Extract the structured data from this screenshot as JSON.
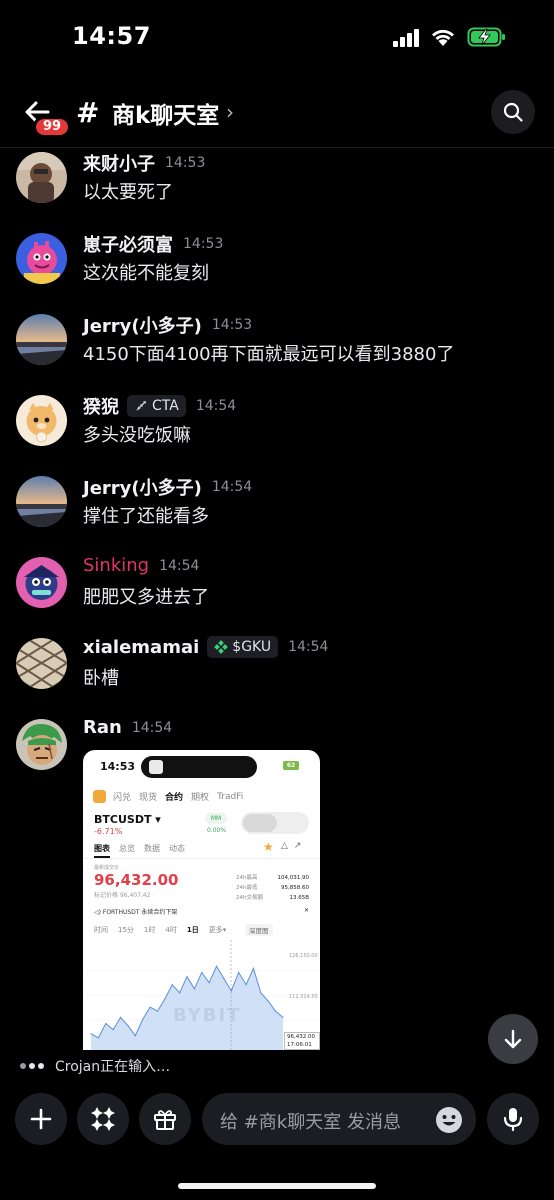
{
  "status_bar": {
    "time": "14:57"
  },
  "header": {
    "unread_count": "99",
    "channel_hash": "#",
    "channel_name": "商k聊天室",
    "chevron": "›"
  },
  "messages": [
    {
      "author": "来财小子",
      "time": "14:53",
      "text": "以太要死了",
      "avatar": "figure-avatar"
    },
    {
      "author": "崽子必须富",
      "time": "14:53",
      "text": "这次能不能复刻",
      "avatar": "pink-monster-avatar"
    },
    {
      "author": "Jerry(小多子)",
      "time": "14:53",
      "text": "4150下面4100再下面就最远可以看到3880了",
      "avatar": "sunset-river-avatar"
    },
    {
      "author": "猤猊",
      "time": "14:54",
      "tag": "CTA",
      "tag_icon": "rocket-icon",
      "text": "多头没吃饭嘛",
      "avatar": "cute-tiger-avatar"
    },
    {
      "author": "Jerry(小多子)",
      "time": "14:54",
      "text": "撑住了还能看多",
      "avatar": "sunset-river-avatar"
    },
    {
      "author": "Sinking",
      "time": "14:54",
      "text": "肥肥又多进去了",
      "avatar": "cartoon-avatar",
      "author_color": "#e0336d"
    },
    {
      "author": "xialemamai",
      "time": "14:54",
      "tag": "$GKU",
      "tag_icon": "clover-icon",
      "text": "卧槽",
      "avatar": "floor-tile-avatar"
    },
    {
      "author": "Ran",
      "time": "14:54",
      "avatar": "green-hair-avatar"
    }
  ],
  "attachment": {
    "time": "14:53",
    "battery": "62",
    "nav": [
      "闪兑",
      "现货",
      "合约",
      "期权",
      "TradFi"
    ],
    "nav_active": "合约",
    "pair": "BTCUSDT ▾",
    "change": "-6.71%",
    "mm_label": "MM",
    "mm_value": "0.00%",
    "tabs": [
      "图表",
      "总览",
      "数据",
      "动态"
    ],
    "tab_active": "图表",
    "last_price_label": "最新成交价",
    "last_price": "96,432.00",
    "mark_price": "标记价格 96,407.42",
    "stats_labels": [
      "24h最高",
      "24h最低",
      "24h交易额"
    ],
    "stats_values": [
      "104,031.90",
      "95,858.60",
      "13.65B"
    ],
    "banner": "FORTHUSDT 永续合约下架",
    "banner_close": "✕",
    "intervals": [
      "时间",
      "15分",
      "1时",
      "4时",
      "1日",
      "更多▾"
    ],
    "interval_active": "1日",
    "depth_label": "深度图",
    "axis_labels": [
      "126,150.00",
      "111,314.50"
    ],
    "current_box": [
      "96,432.00",
      "17:06:01"
    ],
    "watermark": "BYBIT",
    "chart_data": {
      "type": "area",
      "values": [
        88,
        86,
        93,
        90,
        96,
        92,
        87,
        95,
        101,
        99,
        105,
        112,
        108,
        116,
        110,
        118,
        113,
        121,
        115,
        109,
        118,
        112,
        120,
        108,
        104,
        99,
        96
      ]
    }
  },
  "typing": {
    "text": "Crojan正在输入…"
  },
  "composer": {
    "placeholder": "给 #商k聊天室 发消息"
  }
}
